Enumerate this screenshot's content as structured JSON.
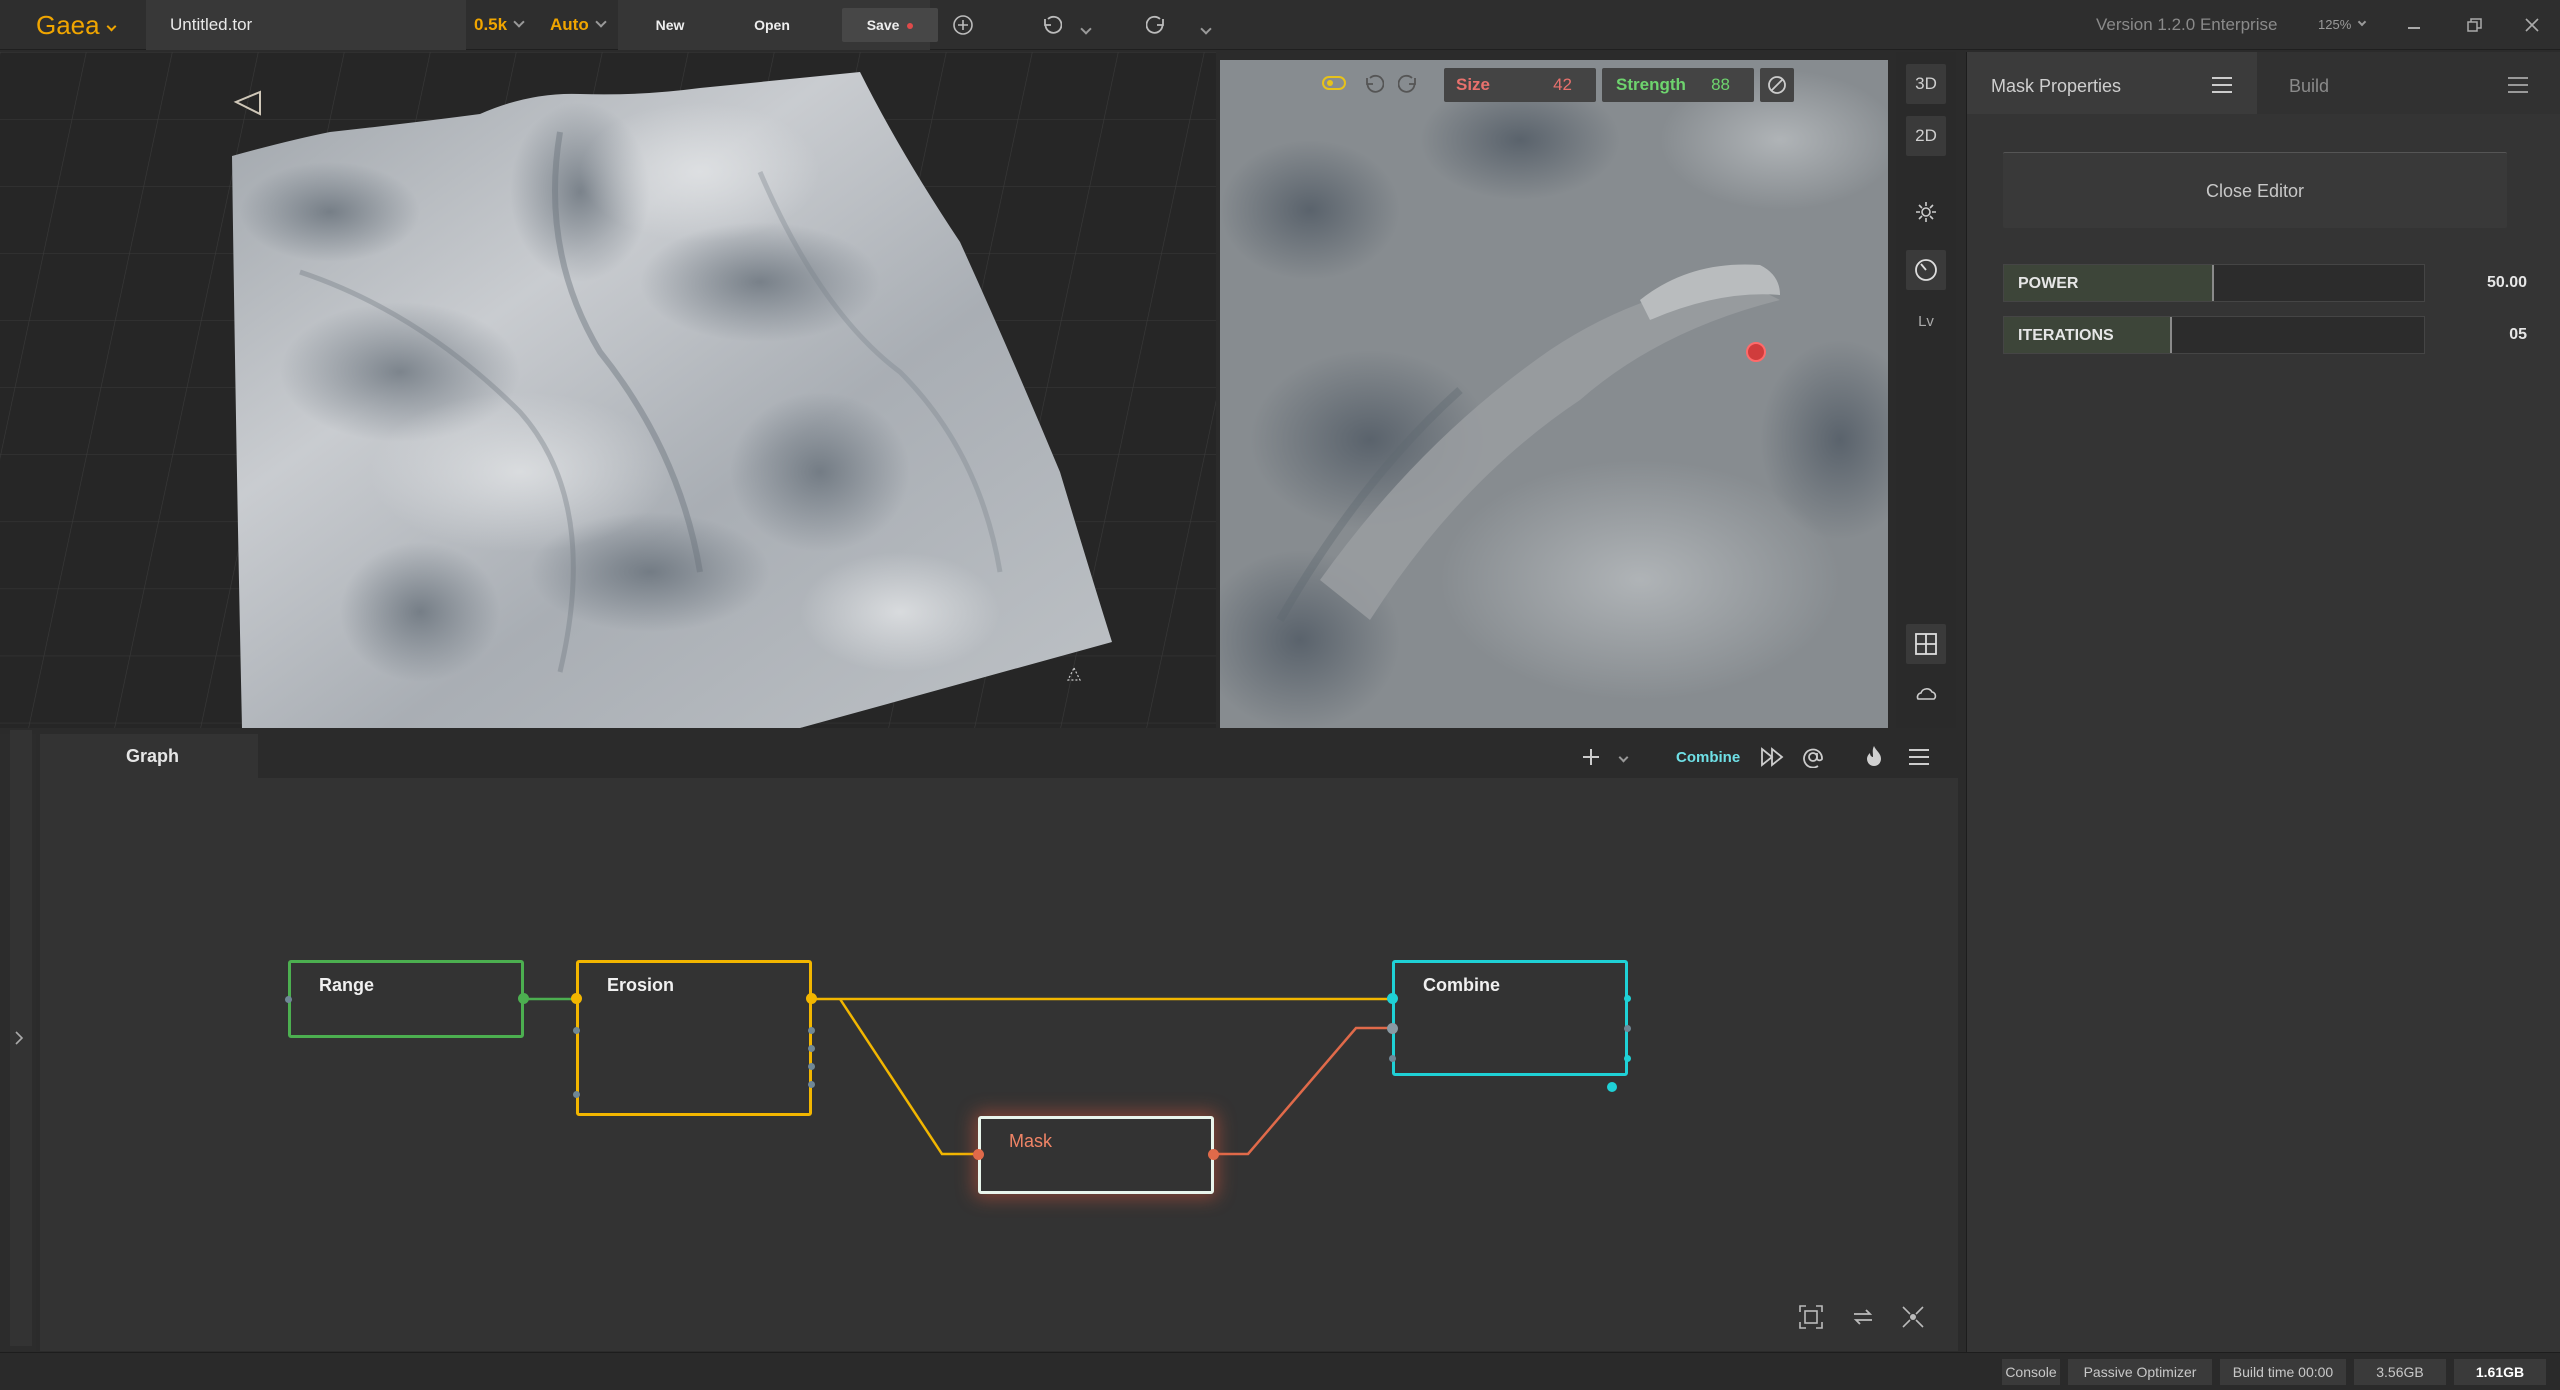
{
  "topbar": {
    "app_name": "Gaea",
    "file_name": "Untitled.tor",
    "resolution": "0.5k",
    "mode": "Auto",
    "new_label": "New",
    "open_label": "Open",
    "save_label": "Save",
    "version": "Version 1.2.0 Enterprise",
    "zoom": "125%"
  },
  "preview2d": {
    "size_label": "Size",
    "size_value": "42",
    "strength_label": "Strength",
    "strength_value": "88"
  },
  "view_tools": {
    "btn_3d": "3D",
    "btn_2d": "2D",
    "btn_lv": "Lv"
  },
  "props": {
    "tab_mask": "Mask Properties",
    "tab_build": "Build",
    "close_editor": "Close Editor",
    "params": [
      {
        "name": "POWER",
        "value": "50.00",
        "fill": 0.5
      },
      {
        "name": "ITERATIONS",
        "value": "05",
        "fill": 0.4
      }
    ]
  },
  "graph": {
    "tab": "Graph",
    "active_node": "Combine",
    "nodes": {
      "range": "Range",
      "erosion": "Erosion",
      "mask": "Mask",
      "combine": "Combine"
    }
  },
  "status": {
    "console": "Console",
    "optimizer": "Passive Optimizer",
    "build_time": "Build time 00:00",
    "mem1": "3.56GB",
    "mem2": "1.61GB"
  },
  "colors": {
    "accent_orange": "#f0a500",
    "range_green": "#4caf50",
    "erosion_yellow": "#f2b600",
    "mask_red": "#e06a4a",
    "combine_cyan": "#1fd1d6",
    "size_red": "#e8716d",
    "strength_green": "#6ed46e"
  }
}
